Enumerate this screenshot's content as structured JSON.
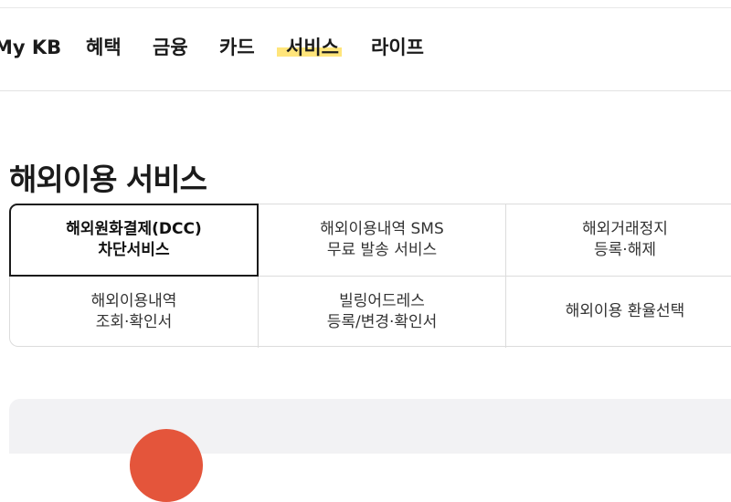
{
  "gnb": {
    "items": [
      {
        "label": "My KB"
      },
      {
        "label": "혜택"
      },
      {
        "label": "금융"
      },
      {
        "label": "카드"
      },
      {
        "label": "서비스",
        "active": true
      },
      {
        "label": "라이프"
      }
    ],
    "highlight_color": "#ffdc4f"
  },
  "page": {
    "title": "해외이용 서비스"
  },
  "tabs": [
    {
      "lines": [
        "해외원화결제(DCC)",
        "차단서비스"
      ],
      "selected": true
    },
    {
      "lines": [
        "해외이용내역 SMS",
        "무료 발송 서비스"
      ]
    },
    {
      "lines": [
        "해외거래정지",
        "등록·해제"
      ]
    },
    {
      "lines": [
        "해외이용내역",
        "조회·확인서"
      ]
    },
    {
      "lines": [
        "빌링어드레스",
        "등록/변경·확인서"
      ]
    },
    {
      "lines": [
        "해외이용 환율선택"
      ]
    }
  ],
  "banner": {
    "circle_color": "#e4553b"
  }
}
